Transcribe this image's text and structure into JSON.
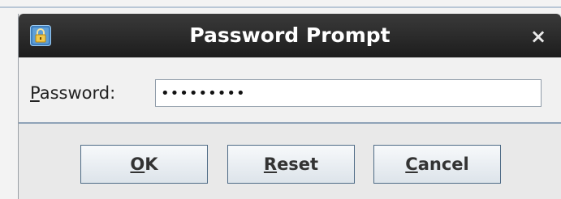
{
  "dialog": {
    "title": "Password Prompt",
    "icon": "lock-app-icon",
    "close_glyph": "×"
  },
  "form": {
    "label_mnemonic": "P",
    "label_rest": "assword:",
    "value": "•••••••••"
  },
  "buttons": {
    "ok_mnemonic": "O",
    "ok_rest": "K",
    "reset_mnemonic": "R",
    "reset_rest": "eset",
    "cancel_mnemonic": "C",
    "cancel_rest": "ancel"
  },
  "colors": {
    "titlebar": "#1d1d1d",
    "button_border": "#4f6b86",
    "separator": "#8fa3b8"
  }
}
